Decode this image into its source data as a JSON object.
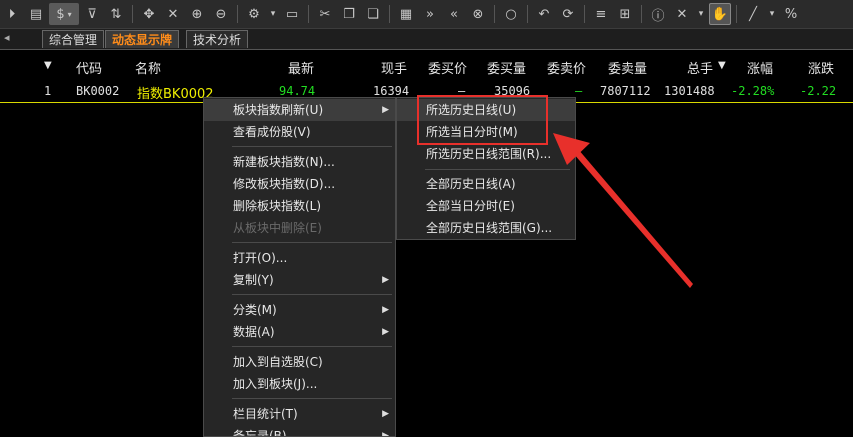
{
  "toolbar": {
    "icons": [
      "play-circle-icon",
      "document-icon",
      "dollar-icon",
      "filter-formula-icon",
      "sort-icon",
      "move-icon",
      "crosshair-icon",
      "zoom-in-icon",
      "zoom-out-icon",
      "settings-icon",
      "save-icon",
      "cut-icon",
      "copy-icon",
      "paste-icon",
      "chart-icon",
      "forward-icon",
      "back-icon",
      "stop-icon",
      "search-icon",
      "undo-icon",
      "refresh-icon",
      "list-icon",
      "grid-icon",
      "info-icon",
      "close-icon",
      "hand-icon",
      "line-tool-icon",
      "percent-icon"
    ],
    "dollar_label": "$"
  },
  "tabs": [
    "综合管理",
    "动态显示牌",
    "技术分析"
  ],
  "active_tab": "动态显示牌",
  "table": {
    "headers": [
      "代码",
      "名称",
      "最新",
      "现手",
      "委买价",
      "委买量",
      "委卖价",
      "委卖量",
      "总手",
      "涨幅",
      "涨跌"
    ],
    "sort_indicator": "▼",
    "row": {
      "index": "1",
      "code": "BK0002",
      "name": "指数BK0002",
      "latest": "94.74",
      "volume_now": "16394",
      "bid_price": "—",
      "bid_volume": "35096",
      "ask_price": "—",
      "ask_volume": "7807112",
      "total_volume": "1301488",
      "change_pct": "-2.28%",
      "change": "-2.22"
    }
  },
  "context_menu": {
    "items": [
      {
        "label": "板块指数刷新(U)",
        "submenu": true,
        "highlighted": true
      },
      {
        "label": "查看成份股(V)"
      },
      {
        "label": "新建板块指数(N)..."
      },
      {
        "label": "修改板块指数(D)..."
      },
      {
        "label": "删除板块指数(L)"
      },
      {
        "label": "从板块中删除(E)",
        "disabled": true
      },
      {
        "label": "打开(O)..."
      },
      {
        "label": "复制(Y)",
        "submenu": true
      },
      {
        "label": "分类(M)",
        "submenu": true
      },
      {
        "label": "数据(A)",
        "submenu": true
      },
      {
        "label": "加入到自选股(C)"
      },
      {
        "label": "加入到板块(J)..."
      },
      {
        "label": "栏目统计(T)",
        "submenu": true
      },
      {
        "label": "备忘录(B)",
        "submenu": true
      }
    ]
  },
  "submenu": {
    "items": [
      {
        "label": "所选历史日线(U)"
      },
      {
        "label": "所选当日分时(M)"
      },
      {
        "label": "所选历史日线范围(R)..."
      },
      {
        "label": "全部历史日线(A)"
      },
      {
        "label": "全部当日分时(E)"
      },
      {
        "label": "全部历史日线范围(G)..."
      }
    ]
  },
  "colors": {
    "highlight_box": "#e8302b",
    "active_tab": "#ff8c1a",
    "name_text": "#f0f000",
    "down_text": "#22dd22"
  }
}
